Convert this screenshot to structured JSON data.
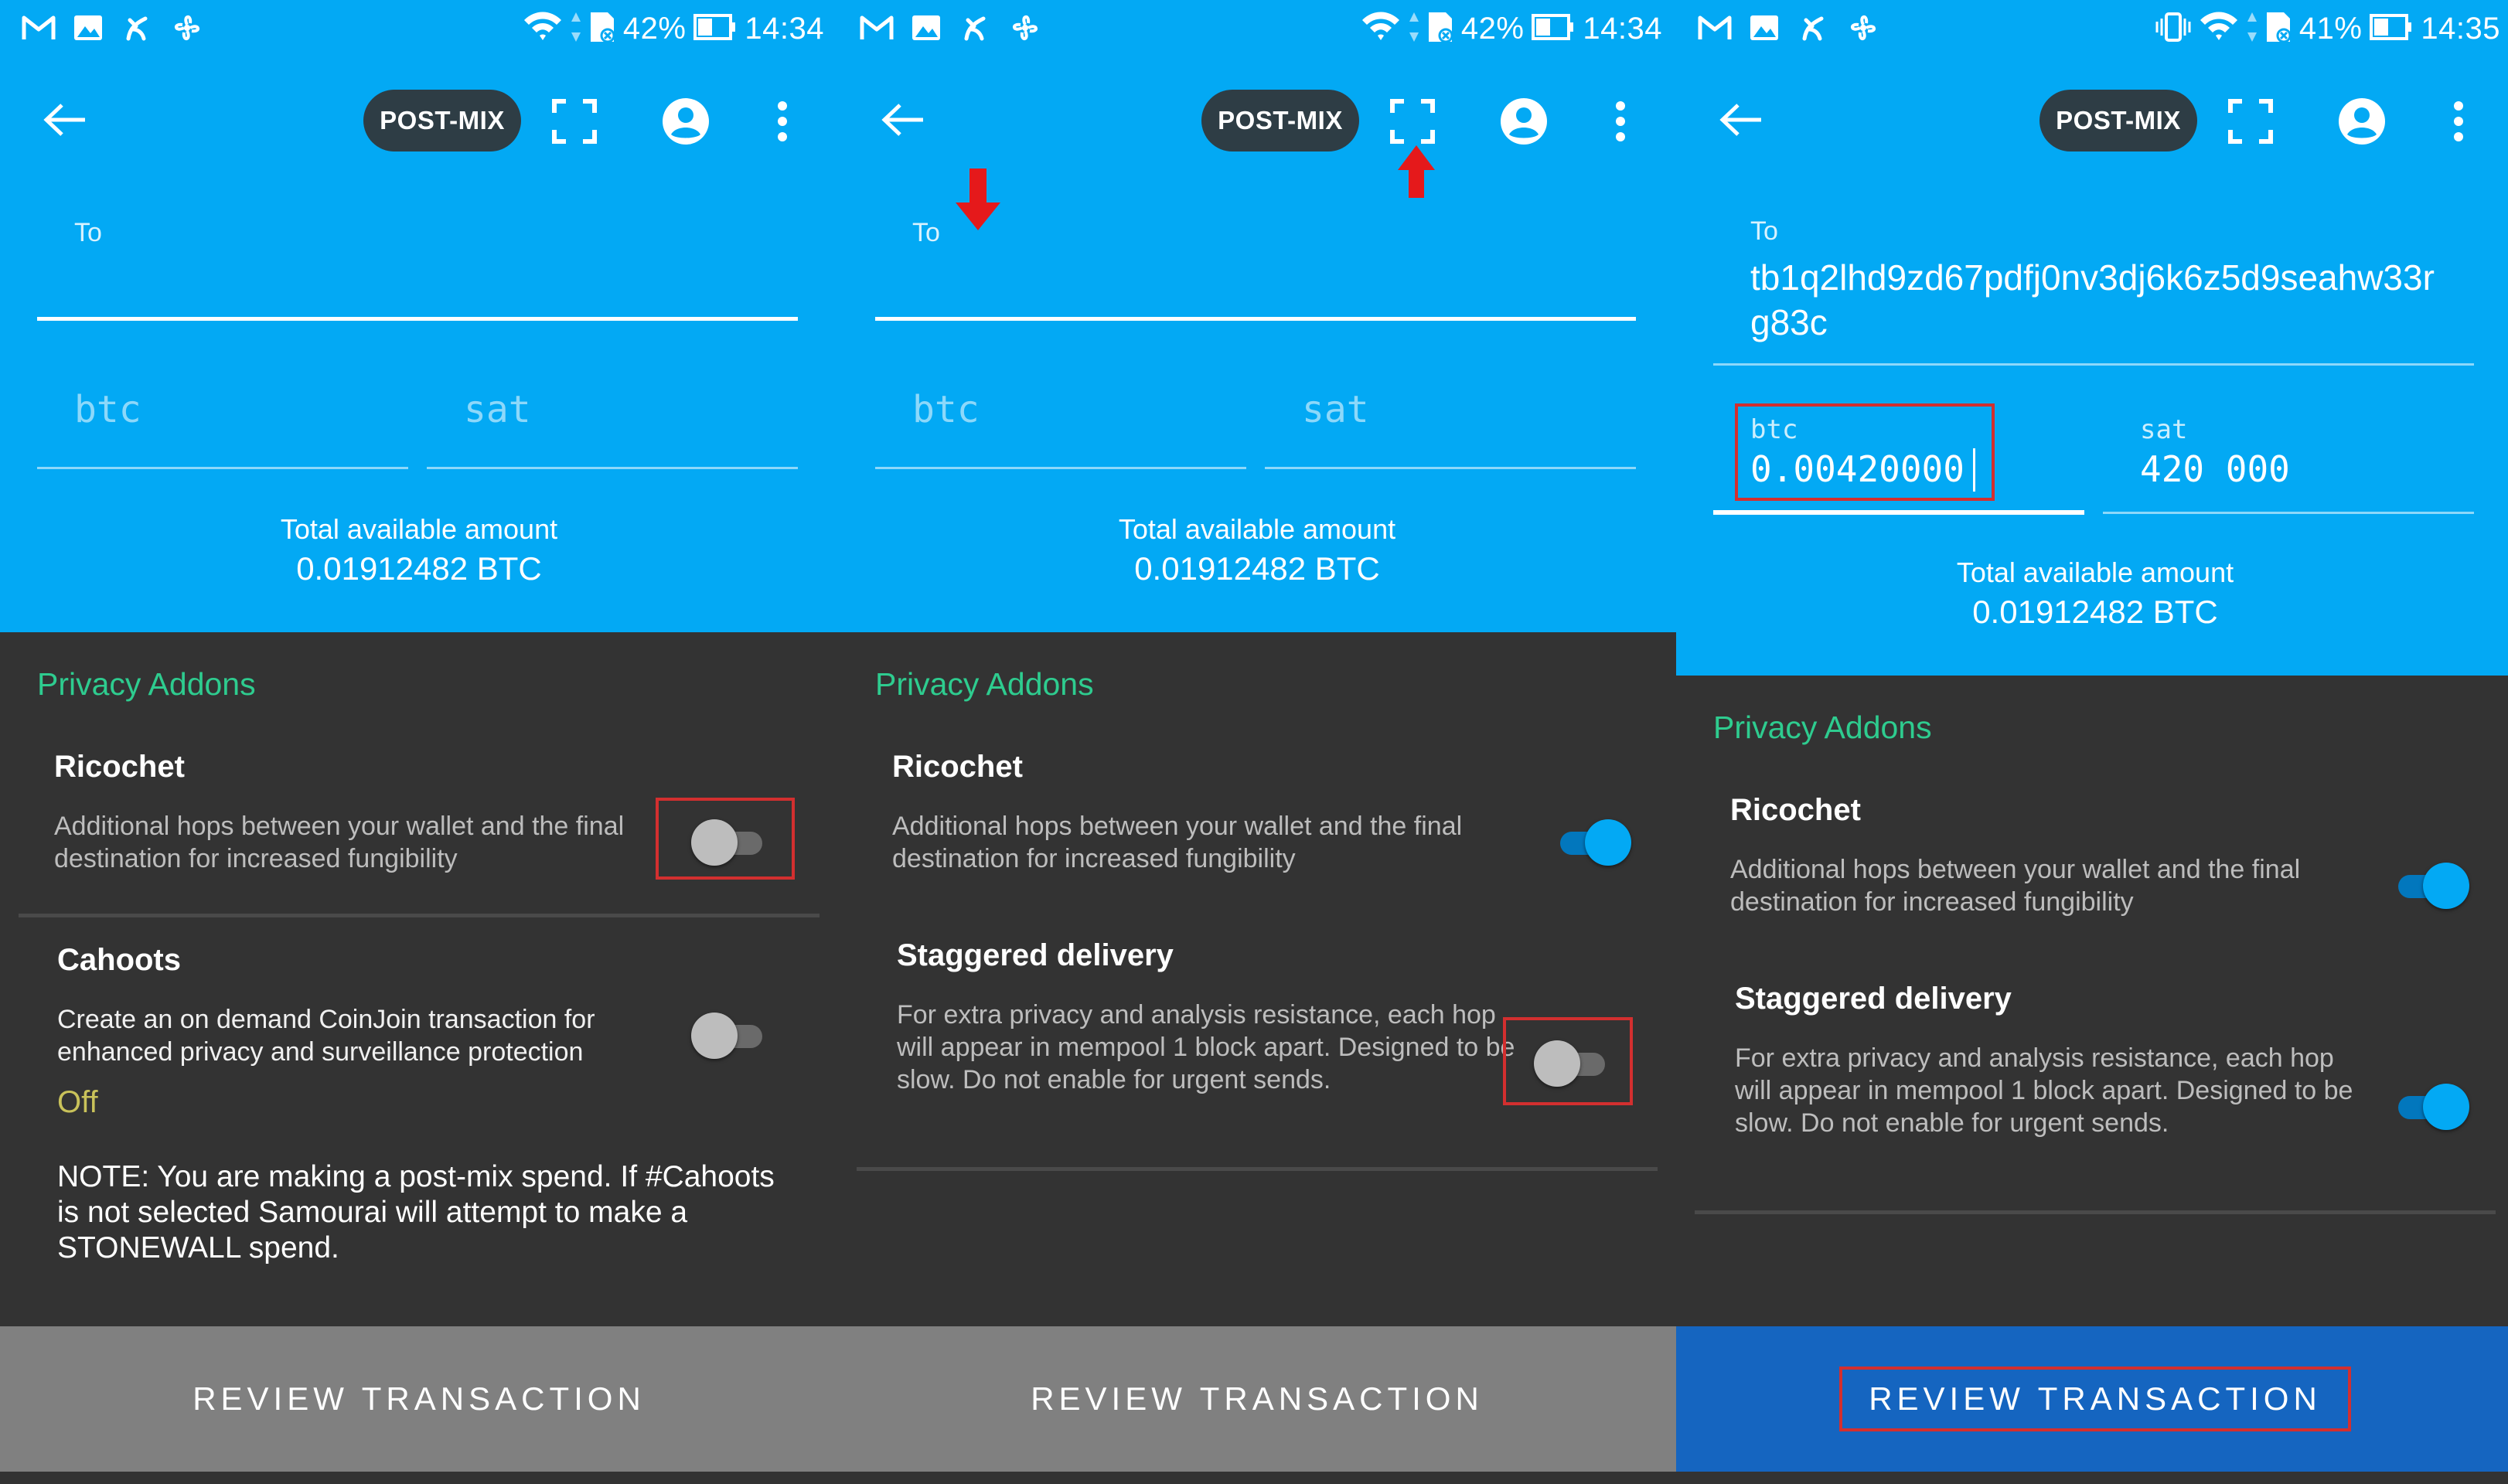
{
  "colors": {
    "primary": "#03A9F4",
    "dark_bg": "#333333",
    "accent_green": "#2ecc8f",
    "button_active": "#1565C0",
    "highlight": "#d32f2f"
  },
  "panels": [
    {
      "status": {
        "battery": "42%",
        "time": "14:34"
      },
      "chip": "POST-MIX",
      "to_label": "To",
      "to_value": "",
      "btc_label": "btc",
      "btc_value": "",
      "sat_label": "sat",
      "sat_value": "",
      "avail_label": "Total available amount",
      "avail_value": "0.01912482 BTC",
      "section": "Privacy Addons",
      "options": [
        {
          "title": "Ricochet",
          "desc": "Additional hops between your wallet and the final destination for increased fungibility",
          "enabled": false
        },
        {
          "title": "Cahoots",
          "desc": "Create an on demand CoinJoin transaction for enhanced privacy and surveillance protection",
          "state": "Off",
          "enabled": false
        }
      ],
      "note": "NOTE: You are making a post-mix spend. If #Cahoots is not selected Samourai will attempt to make a STONEWALL spend.",
      "review": "REVIEW TRANSACTION"
    },
    {
      "status": {
        "battery": "42%",
        "time": "14:34"
      },
      "chip": "POST-MIX",
      "to_label": "To",
      "to_value": "",
      "btc_label": "btc",
      "btc_value": "",
      "sat_label": "sat",
      "sat_value": "",
      "avail_label": "Total available amount",
      "avail_value": "0.01912482 BTC",
      "section": "Privacy Addons",
      "options": [
        {
          "title": "Ricochet",
          "desc": "Additional hops between your wallet and the final destination for increased fungibility",
          "enabled": true
        },
        {
          "title": "Staggered delivery",
          "desc": "For extra privacy and analysis resistance, each hop will appear in mempool 1 block apart. Designed to be slow. Do not enable for urgent sends.",
          "enabled": false
        }
      ],
      "review": "REVIEW TRANSACTION"
    },
    {
      "status": {
        "battery": "41%",
        "time": "14:35"
      },
      "chip": "POST-MIX",
      "to_label": "To",
      "to_value": "tb1q2lhd9zd67pdfj0nv3dj6k6z5d9seahw33rg83c",
      "btc_label": "btc",
      "btc_value": "0.00420000",
      "sat_label": "sat",
      "sat_value": "420 000",
      "avail_label": "Total available amount",
      "avail_value": "0.01912482 BTC",
      "section": "Privacy Addons",
      "options": [
        {
          "title": "Ricochet",
          "desc": "Additional hops between your wallet and the final destination for increased fungibility",
          "enabled": true
        },
        {
          "title": "Staggered delivery",
          "desc": "For extra privacy and analysis resistance, each hop will appear in mempool 1 block apart. Designed to be slow. Do not enable for urgent sends.",
          "enabled": true
        }
      ],
      "review": "REVIEW TRANSACTION"
    }
  ]
}
